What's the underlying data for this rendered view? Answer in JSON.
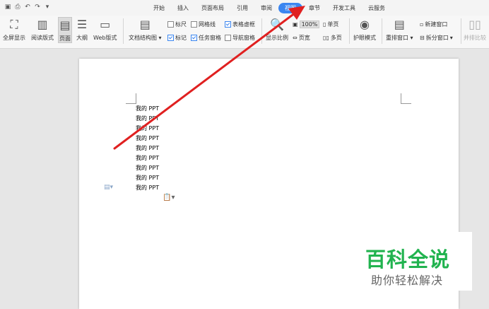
{
  "quick_access": [
    "save-icon",
    "print-icon",
    "undo-icon",
    "redo-icon",
    "dropdown-icon"
  ],
  "tabs": [
    "开始",
    "插入",
    "页面布局",
    "引用",
    "审阅",
    "视图",
    "章节",
    "开发工具",
    "云服务"
  ],
  "active_tab": "视图",
  "ribbon": {
    "fullscreen": "全屏显示",
    "reading": "阅读版式",
    "page": "页面",
    "outline": "大纲",
    "web": "Web版式",
    "docmap": "文档结构图",
    "ruler": "标尺",
    "gridlines": "网格线",
    "table_gridlines": "表格虚框",
    "marks": "标记",
    "task_pane": "任务窗格",
    "nav_pane": "导航窗格",
    "zoom_ratio": "显示比例",
    "zoom_value": "100%",
    "single_page": "单页",
    "page_width": "页宽",
    "multi_page": "多页",
    "eye_mode": "护眼模式",
    "arrange": "重排窗口",
    "new_window": "新建窗口",
    "split_window": "拆分窗口",
    "side_by_side": "并排比较"
  },
  "document_lines": [
    "我的 PPT",
    "我的 PPT",
    "我的 PPT",
    "我的 PPT",
    "我的 PPT",
    "我的 PPT",
    "我的 PPT",
    "我的 PPT",
    "我的 PPT"
  ],
  "watermark": {
    "title": "百科全说",
    "subtitle": "助你轻松解决",
    "color": "#21b34f"
  },
  "accent_color": "#3b86f0",
  "arrow_color": "#e02020"
}
